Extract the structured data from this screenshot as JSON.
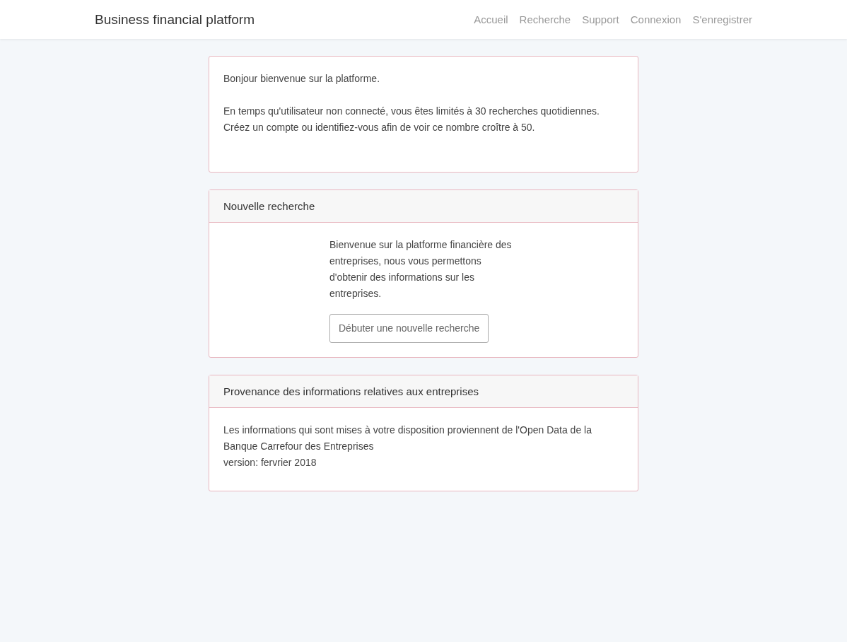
{
  "navbar": {
    "brand": "Business financial platform",
    "links": [
      "Accueil",
      "Recherche",
      "Support",
      "Connexion",
      "S'enregistrer"
    ]
  },
  "welcome_card": {
    "paragraphs": [
      "Bonjour bienvenue sur la platforme.",
      "En temps qu'utilisateur non connecté, vous êtes limités à 30 recherches quotidiennes. Créez un compte ou identifiez-vous afin de voir ce nombre croître à 50."
    ]
  },
  "search_card": {
    "header": "Nouvelle recherche",
    "text": "Bienvenue sur la platforme financière des entreprises, nous vous permettons d'obtenir des informations sur les entreprises.",
    "button": "Débuter une nouvelle recherche"
  },
  "source_card": {
    "header": "Provenance des informations relatives aux entreprises",
    "lines": [
      "Les informations qui sont mises à votre disposition proviennent de l'Open Data de la Banque Carrefour des Entreprises",
      "version: fervrier 2018"
    ]
  }
}
